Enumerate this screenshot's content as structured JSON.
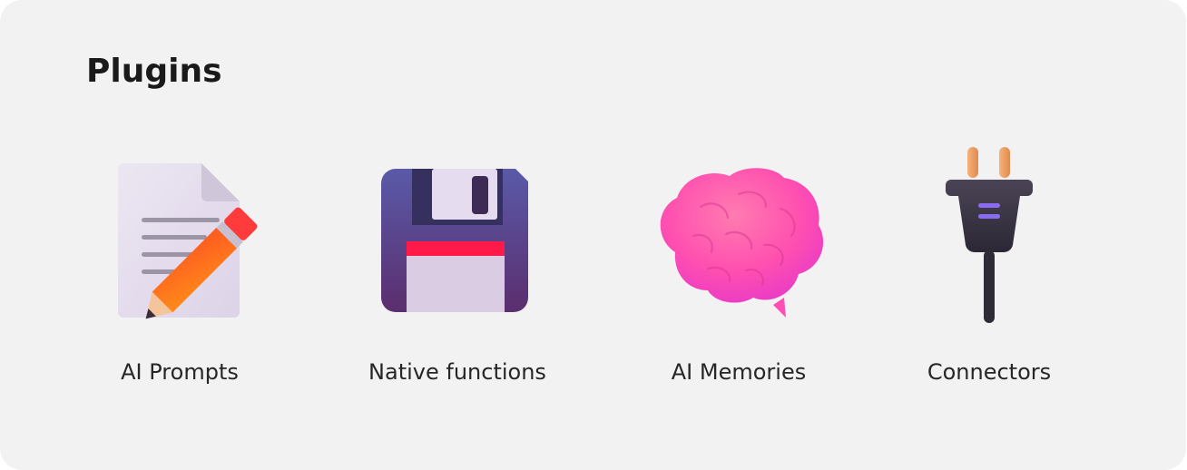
{
  "header": {
    "title": "Plugins"
  },
  "plugins": [
    {
      "label": "AI Prompts",
      "icon": "document-pencil-icon"
    },
    {
      "label": "Native functions",
      "icon": "floppy-disk-icon"
    },
    {
      "label": "AI Memories",
      "icon": "brain-icon"
    },
    {
      "label": "Connectors",
      "icon": "electric-plug-icon"
    }
  ],
  "colors": {
    "background": "#f2f2f2",
    "title_text": "#1a1a1a",
    "label_text": "#262626"
  }
}
